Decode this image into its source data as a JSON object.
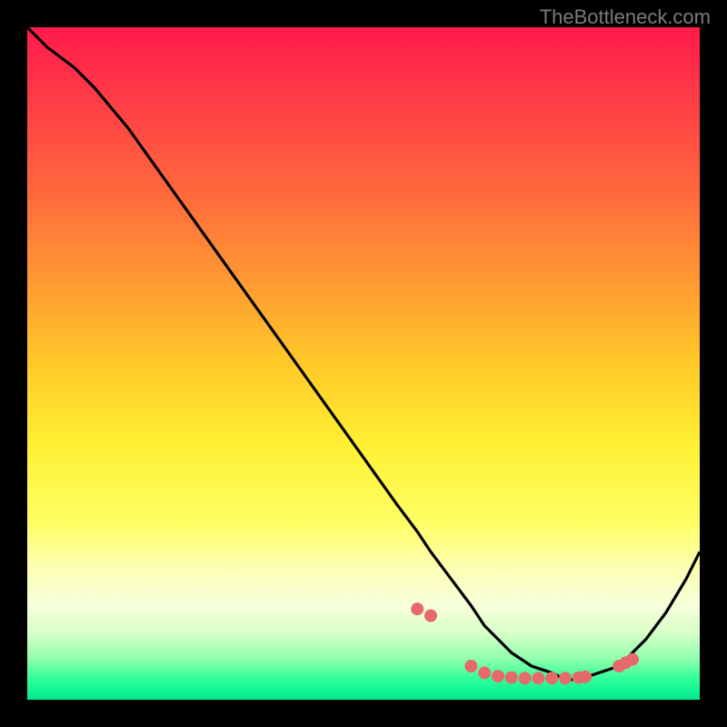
{
  "watermark": "TheBottleneck.com",
  "chart_data": {
    "type": "line",
    "title": "",
    "xlabel": "",
    "ylabel": "",
    "xlim": [
      0,
      100
    ],
    "ylim": [
      0,
      100
    ],
    "series": [
      {
        "name": "curve",
        "x": [
          0,
          3,
          7,
          10,
          15,
          20,
          25,
          30,
          35,
          40,
          45,
          50,
          55,
          58,
          60,
          63,
          66,
          68,
          70,
          72,
          75,
          78,
          80,
          82,
          85,
          88,
          90,
          92,
          95,
          98,
          100
        ],
        "y": [
          100,
          97,
          94,
          91,
          85,
          78,
          71,
          64,
          57,
          50,
          43,
          36,
          29,
          25,
          22,
          18,
          14,
          11,
          9,
          7,
          5,
          4,
          3,
          3,
          4,
          5,
          7,
          9,
          13,
          18,
          22
        ]
      }
    ],
    "dots": {
      "name": "highlight-dots",
      "x": [
        58,
        60,
        66,
        68,
        70,
        72,
        74,
        76,
        78,
        80,
        82,
        83,
        88,
        89,
        90
      ],
      "y": [
        13.5,
        12.5,
        5,
        4,
        3.5,
        3.3,
        3.2,
        3.2,
        3.2,
        3.2,
        3.3,
        3.4,
        5,
        5.5,
        6
      ]
    }
  }
}
